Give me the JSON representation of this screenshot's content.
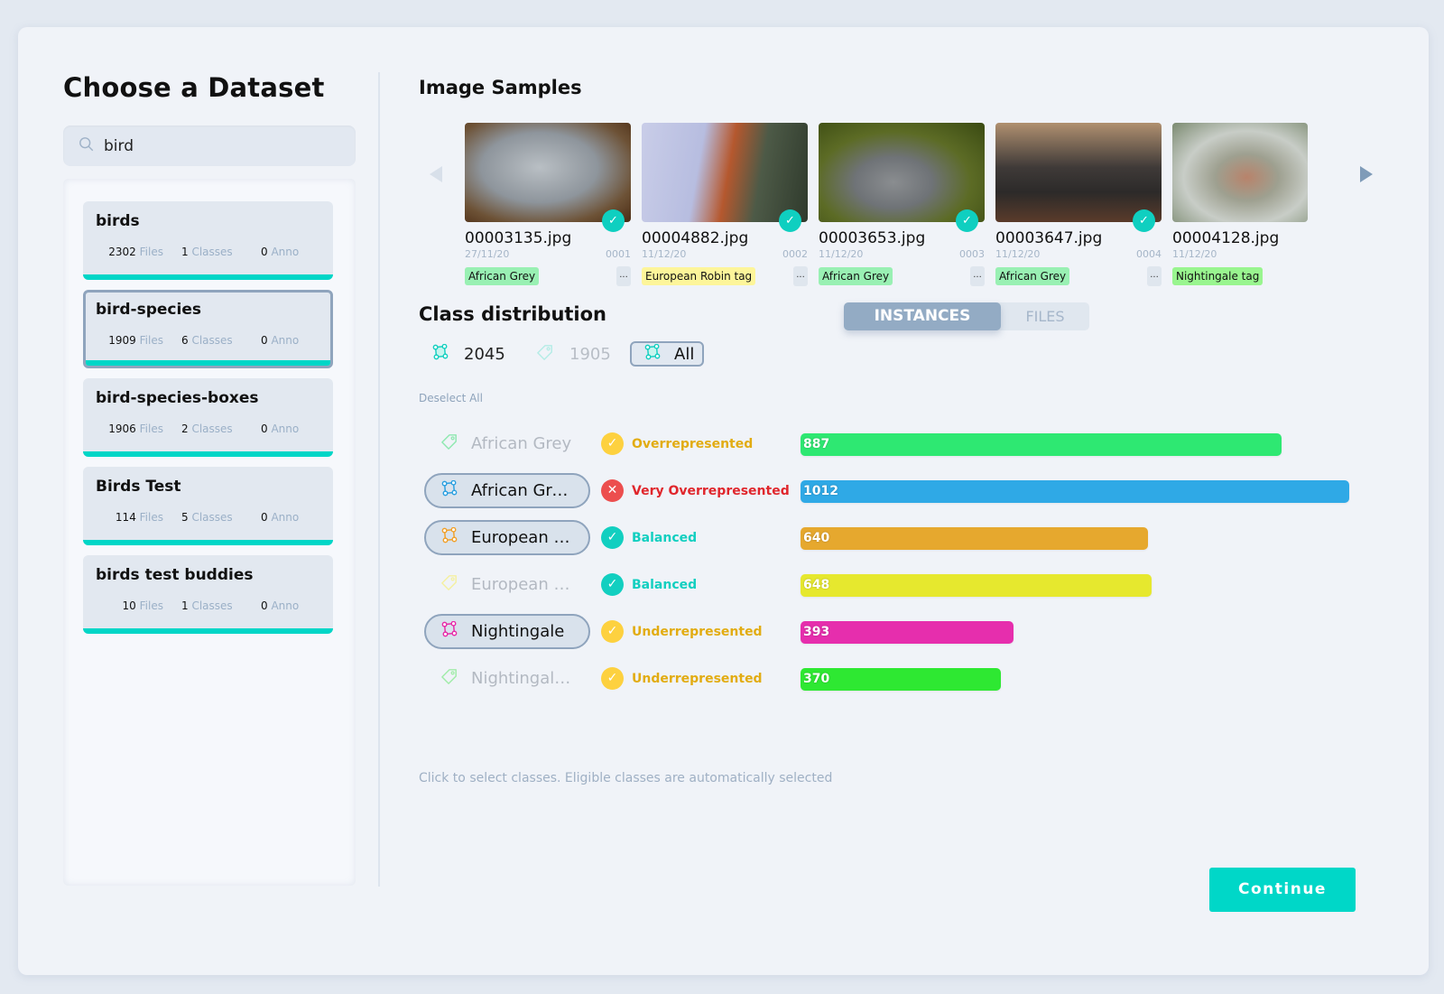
{
  "left": {
    "title": "Choose a Dataset",
    "search": {
      "value": "bird",
      "icon": "search-icon"
    },
    "datasets": [
      {
        "name": "birds",
        "files": "2302",
        "files_label": "Files",
        "classes": "1",
        "classes_label": "Classes",
        "anno": "0",
        "anno_label": "Anno",
        "selected": false
      },
      {
        "name": "bird-species",
        "files": "1909",
        "files_label": "Files",
        "classes": "6",
        "classes_label": "Classes",
        "anno": "0",
        "anno_label": "Anno",
        "selected": true
      },
      {
        "name": "bird-species-boxes",
        "files": "1906",
        "files_label": "Files",
        "classes": "2",
        "classes_label": "Classes",
        "anno": "0",
        "anno_label": "Anno",
        "selected": false
      },
      {
        "name": "Birds Test",
        "files": "114",
        "files_label": "Files",
        "classes": "5",
        "classes_label": "Classes",
        "anno": "0",
        "anno_label": "Anno",
        "selected": false
      },
      {
        "name": "birds test buddies",
        "files": "10",
        "files_label": "Files",
        "classes": "1",
        "classes_label": "Classes",
        "anno": "0",
        "anno_label": "Anno",
        "selected": false
      }
    ]
  },
  "samples": {
    "title": "Image Samples",
    "prev_icon": "arrow-left-icon",
    "next_icon": "arrow-right-icon",
    "items": [
      {
        "filename": "00003135.jpg",
        "date": "27/11/20",
        "index": "0001",
        "tag": "African Grey",
        "tag_color": "#99f0b3",
        "checked": true,
        "more": "..."
      },
      {
        "filename": "00004882.jpg",
        "date": "11/12/20",
        "index": "0002",
        "tag": "European Robin tag",
        "tag_color": "#fdf59a",
        "checked": true,
        "more": "..."
      },
      {
        "filename": "00003653.jpg",
        "date": "11/12/20",
        "index": "0003",
        "tag": "African Grey",
        "tag_color": "#99f0b3",
        "checked": true,
        "more": "..."
      },
      {
        "filename": "00003647.jpg",
        "date": "11/12/20",
        "index": "0004",
        "tag": "African Grey",
        "tag_color": "#99f0b3",
        "checked": true,
        "more": "..."
      },
      {
        "filename": "00004128.jpg",
        "date": "11/12/20",
        "index": "",
        "tag": "Nightingale tag",
        "tag_color": "#99f58f",
        "checked": false,
        "more": ""
      }
    ]
  },
  "distribution": {
    "title": "Class distribution",
    "instances_count": "2045",
    "tags_count": "1905",
    "all_label": "All",
    "toggle": {
      "instances": "INSTANCES",
      "files": "FILES",
      "active": "instances"
    },
    "deselect_label": "Deselect All",
    "hint": "Click to select classes. Eligible classes are automatically selected",
    "max_value": 1012,
    "classes": [
      {
        "label": "African Grey",
        "kind": "tag",
        "active": false,
        "icon_color": "#8ee8b0",
        "status": "Overrepresented",
        "status_type": "warn",
        "value": 887,
        "bar_color": "#2ee872"
      },
      {
        "label": "African Gre…",
        "kind": "polygon",
        "active": true,
        "icon_color": "#2a9fe0",
        "status": "Very Overrepresented",
        "status_type": "bad",
        "value": 1012,
        "bar_color": "#2fa9e6"
      },
      {
        "label": "European …",
        "kind": "polygon",
        "active": true,
        "icon_color": "#f0a02a",
        "status": "Balanced",
        "status_type": "good",
        "value": 640,
        "bar_color": "#e6a82e"
      },
      {
        "label": "European …",
        "kind": "tag",
        "active": false,
        "icon_color": "#f4f0a0",
        "status": "Balanced",
        "status_type": "good",
        "value": 648,
        "bar_color": "#e6e82e"
      },
      {
        "label": "Nightingale",
        "kind": "polygon",
        "active": true,
        "icon_color": "#e62aa8",
        "status": "Underrepresented",
        "status_type": "warn",
        "value": 393,
        "bar_color": "#e62ead"
      },
      {
        "label": "Nightingale…",
        "kind": "tag",
        "active": false,
        "icon_color": "#a0eca8",
        "status": "Underrepresented",
        "status_type": "warn",
        "value": 370,
        "bar_color": "#2ee832"
      }
    ]
  },
  "status_styles": {
    "warn": {
      "dot": "#fdd13f",
      "text": "#e2ac12",
      "glyph": "✓"
    },
    "bad": {
      "dot": "#ec4e4e",
      "text": "#e0262c",
      "glyph": "✕"
    },
    "good": {
      "dot": "#12cfc0",
      "text": "#12cfc0",
      "glyph": "✓"
    }
  },
  "footer": {
    "continue_label": "Continue"
  }
}
